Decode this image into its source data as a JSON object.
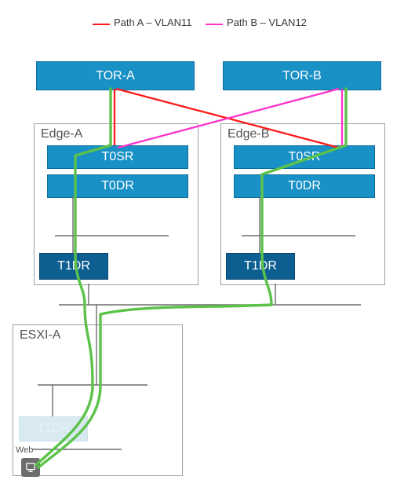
{
  "legend": {
    "pathA": "Path A – VLAN11",
    "pathB": "Path B – VLAN12",
    "colorA": "#ff1a1a",
    "colorB": "#ff33cc"
  },
  "nodes": {
    "torA": "TOR-A",
    "torB": "TOR-B",
    "t0srA": "T0SR",
    "t0drA": "T0DR",
    "t0srB": "T0SR",
    "t0drB": "T0DR",
    "t1drA": "T1DR",
    "t1drB": "T1DR",
    "t1drEsxi": "T1DR"
  },
  "groups": {
    "edgeA": "Edge-A",
    "edgeB": "Edge-B",
    "esxiA": "ESXI-A"
  },
  "labels": {
    "web": "Web"
  },
  "colors": {
    "dataPath": "#5cc24a",
    "wire": "#6d6d6d"
  },
  "chart_data": {
    "type": "network-diagram",
    "legend": [
      {
        "name": "Path A – VLAN11",
        "color": "#ff1a1a"
      },
      {
        "name": "Path B – VLAN12",
        "color": "#ff33cc"
      }
    ],
    "groups": [
      {
        "id": "Edge-A",
        "children": [
          "T0SR-A",
          "T0DR-A",
          "T1DR-A"
        ]
      },
      {
        "id": "Edge-B",
        "children": [
          "T0SR-B",
          "T0DR-B",
          "T1DR-B"
        ]
      },
      {
        "id": "ESXI-A",
        "children": [
          "T1DR-ESXI",
          "VM-Web"
        ]
      }
    ],
    "nodes": [
      {
        "id": "TOR-A",
        "label": "TOR-A",
        "type": "tor"
      },
      {
        "id": "TOR-B",
        "label": "TOR-B",
        "type": "tor"
      },
      {
        "id": "T0SR-A",
        "label": "T0SR",
        "type": "router"
      },
      {
        "id": "T0DR-A",
        "label": "T0DR",
        "type": "router"
      },
      {
        "id": "T0SR-B",
        "label": "T0SR",
        "type": "router"
      },
      {
        "id": "T0DR-B",
        "label": "T0DR",
        "type": "router"
      },
      {
        "id": "T1DR-A",
        "label": "T1DR",
        "type": "router"
      },
      {
        "id": "T1DR-B",
        "label": "T1DR",
        "type": "router"
      },
      {
        "id": "T1DR-ESXI",
        "label": "T1DR",
        "type": "router",
        "faded": true
      },
      {
        "id": "VM-Web",
        "label": "Web",
        "type": "vm"
      }
    ],
    "links": [
      {
        "from": "TOR-A",
        "to": "T0SR-A",
        "path": "A"
      },
      {
        "from": "TOR-A",
        "to": "T0SR-B",
        "path": "A"
      },
      {
        "from": "TOR-B",
        "to": "T0SR-A",
        "path": "B"
      },
      {
        "from": "TOR-B",
        "to": "T0SR-B",
        "path": "B"
      },
      {
        "from": "T0DR-A",
        "to": "T1DR-A",
        "path": "internal"
      },
      {
        "from": "T0DR-B",
        "to": "T1DR-B",
        "path": "internal"
      },
      {
        "from": "Edge-A",
        "to": "ESXI-A",
        "path": "transport"
      },
      {
        "from": "Edge-B",
        "to": "ESXI-A",
        "path": "transport"
      }
    ],
    "data_paths": [
      {
        "name": "green-path-A",
        "color": "#5cc24a",
        "waypoints": [
          "TOR-A",
          "T0SR-A",
          "T0DR-A",
          "T1DR-A",
          "ESXI-A",
          "VM-Web"
        ]
      },
      {
        "name": "green-path-B",
        "color": "#5cc24a",
        "waypoints": [
          "TOR-B",
          "T0SR-B",
          "T0DR-B",
          "T1DR-B",
          "ESXI-A",
          "VM-Web"
        ]
      }
    ]
  }
}
